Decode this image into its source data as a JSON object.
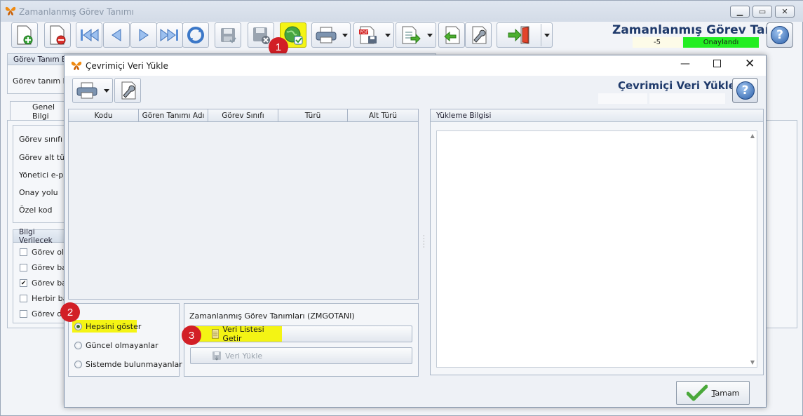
{
  "main": {
    "window_title": "Zamanlanmış Görev Tanımı",
    "header_title": "Zamanlanmış Görev Tanımı",
    "status_number": "-5",
    "status_text": "Onaylandı",
    "status_color": "#22ee22",
    "window_buttons": [
      "minimize-icon",
      "restore-icon",
      "close-icon"
    ],
    "toolbar_icons": [
      "new-record-icon",
      "delete-record-icon",
      "first-record-icon",
      "previous-record-icon",
      "next-record-icon",
      "last-record-icon",
      "refresh-icon",
      "save-icon",
      "cancel-save-icon",
      "online-load-icon",
      "print-icon",
      "pdf-export-icon",
      "export-icon",
      "import-icon",
      "tools-icon",
      "exit-icon"
    ],
    "badges": [
      "1",
      "2",
      "3"
    ],
    "highlight_color": "#f4f414"
  },
  "background_form": {
    "header_label": "Görev Tanım Bil",
    "field_label": "Görev tanım kod",
    "tab_label": "Genel Bilgi",
    "fields": [
      "Görev sınıfı",
      "Görev alt türü",
      "Yönetici e-pos",
      "Onay yolu",
      "Özel kod"
    ],
    "info_header": "Bilgi Verilecek",
    "checks": [
      {
        "label": "Görev oluş",
        "checked": false
      },
      {
        "label": "Görev baş",
        "checked": false
      },
      {
        "label": "Görev baş",
        "checked": true
      },
      {
        "label": "Herbir baş",
        "checked": false
      },
      {
        "label": "Görev ot",
        "checked": false
      }
    ]
  },
  "dialog": {
    "title": "Çevrimiçi Veri Yükle",
    "header_title": "Çevrimiçi Veri Yükle",
    "columns": [
      "Kodu",
      "Gören Tanımı Adı",
      "Görev Sınıfı",
      "Türü",
      "Alt Türü"
    ],
    "load_info_header": "Yükleme Bilgisi",
    "radios": [
      {
        "label": "Hepsini göster",
        "selected": true
      },
      {
        "label": "Güncel olmayanlar",
        "selected": false
      },
      {
        "label": "Sistemde bulunmayanlar",
        "selected": false
      }
    ],
    "group_title": "Zamanlanmış Görev Tanımları (ZMGOTANI)",
    "fetch_button": "Veri Listesi Getir",
    "load_button": "Veri Yükle",
    "ok_button_first": "T",
    "ok_button_rest": "amam"
  }
}
